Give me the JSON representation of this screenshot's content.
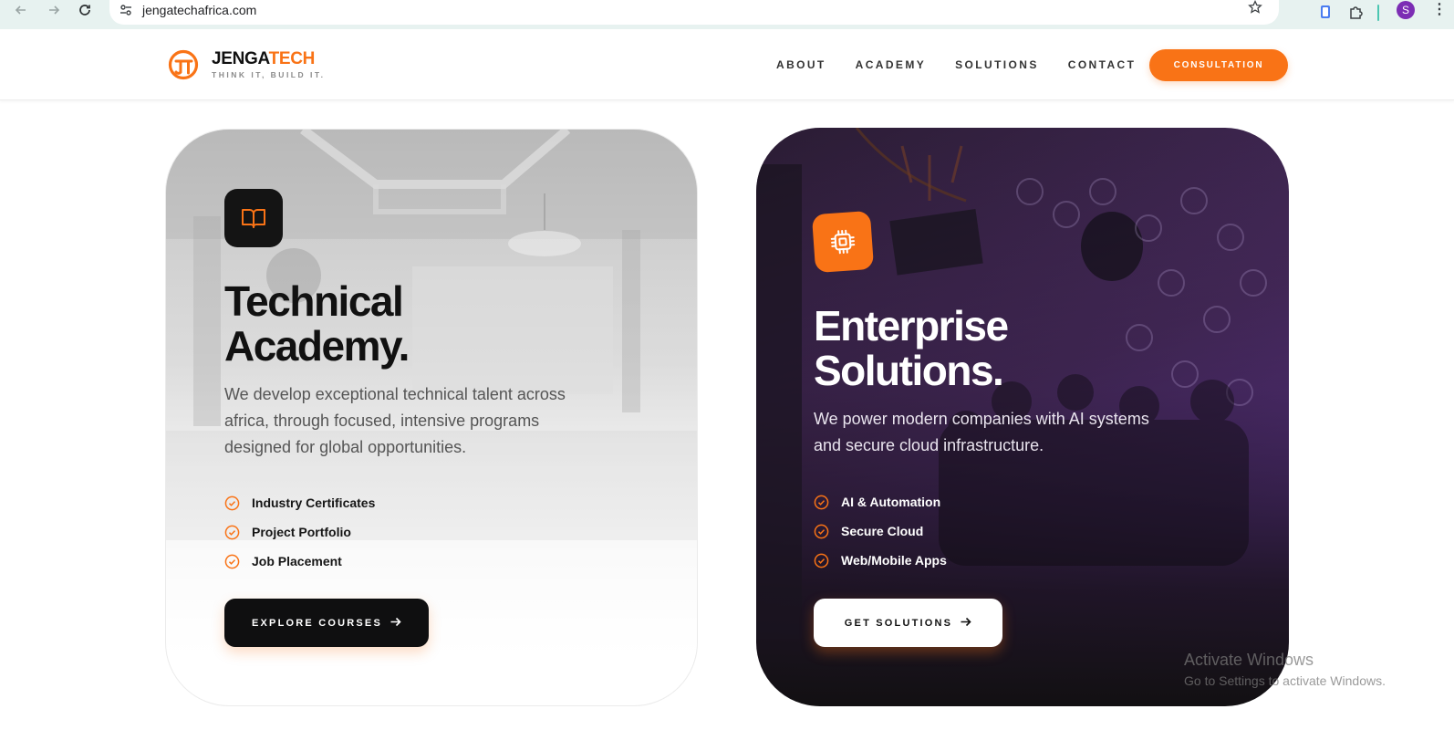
{
  "browser": {
    "url": "jengatechafrica.com",
    "profile_initial": "S",
    "icons": [
      "back-arrow-icon",
      "forward-arrow-icon",
      "reload-icon",
      "site-settings-icon",
      "bookmark-star-icon",
      "extension-icon",
      "puzzle-icon",
      "kebab-menu-icon"
    ]
  },
  "header": {
    "logo_brand_dark": "JENGA",
    "logo_brand_accent": "TECH",
    "logo_tagline": "THINK IT, BUILD IT.",
    "nav": [
      "ABOUT",
      "ACADEMY",
      "SOLUTIONS",
      "CONTACT"
    ],
    "cta_label": "CONSULTATION"
  },
  "academy": {
    "icon": "book-open-icon",
    "title_line1": "Technical",
    "title_line2": "Academy.",
    "description": "We develop exceptional technical talent across africa, through focused, intensive programs designed for global opportunities.",
    "features": [
      "Industry Certificates",
      "Project Portfolio",
      "Job Placement"
    ],
    "button_label": "EXPLORE COURSES"
  },
  "enterprise": {
    "icon": "cpu-chip-icon",
    "title_line1": "Enterprise",
    "title_line2": "Solutions.",
    "description": "We power modern companies with AI systems and secure cloud infrastructure.",
    "features": [
      "AI & Automation",
      "Secure Cloud",
      "Web/Mobile Apps"
    ],
    "button_label": "GET SOLUTIONS"
  },
  "watermark": {
    "title": "Activate Windows",
    "subtitle": "Go to Settings to activate Windows."
  },
  "colors": {
    "accent": "#f97316",
    "dark": "#111111",
    "chrome_bg": "#e7f2f0"
  }
}
